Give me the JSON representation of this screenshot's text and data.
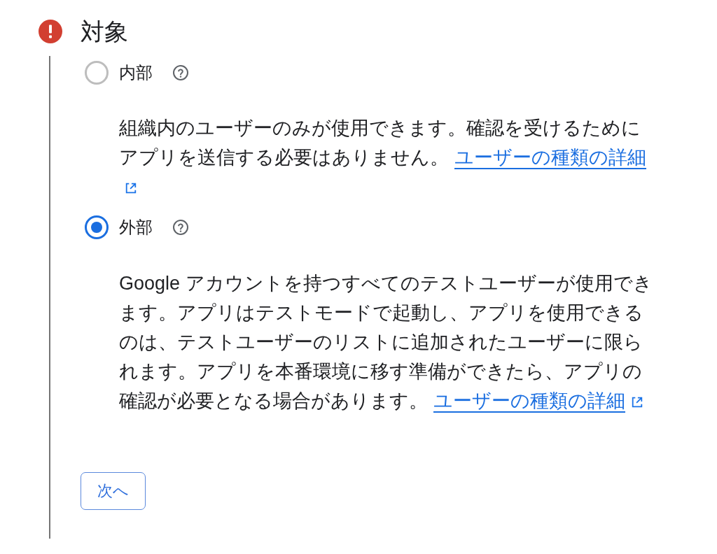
{
  "section": {
    "title": "対象",
    "error": true
  },
  "options": [
    {
      "label": "内部",
      "selected": false,
      "description": "組織内のユーザーのみが使用できます。確認を受けるためにアプリを送信する必要はありません。",
      "link": "ユーザーの種類の詳細"
    },
    {
      "label": "外部",
      "selected": true,
      "description": "Google アカウントを持つすべてのテストユーザーが使用できます。アプリはテストモードで起動し、アプリを使用できるのは、テストユーザーのリストに追加されたユーザーに限られます。アプリを本番環境に移す準備ができたら、アプリの確認が必要となる場合があります。",
      "link": "ユーザーの種類の詳細"
    }
  ],
  "buttons": [
    {
      "label": "次へ"
    }
  ]
}
